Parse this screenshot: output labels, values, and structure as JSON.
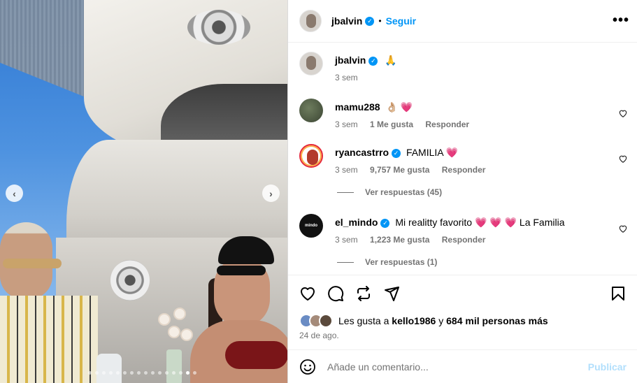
{
  "header": {
    "username": "jbalvin",
    "separator": "•",
    "follow_label": "Seguir",
    "more_label": "•••"
  },
  "caption": {
    "username": "jbalvin",
    "text": "🙏",
    "time": "3 sem"
  },
  "comments": [
    {
      "username": "mamu288",
      "text": "👌🏼 💗",
      "time": "3 sem",
      "likes": "1 Me gusta",
      "reply_label": "Responder",
      "verified": false
    },
    {
      "username": "ryancastrro",
      "text": "FAMILIA 💗",
      "time": "3 sem",
      "likes": "9,757 Me gusta",
      "reply_label": "Responder",
      "verified": true,
      "view_replies": "Ver respuestas (45)"
    },
    {
      "username": "el_mindo",
      "text": "Mi realitty favorito 💗 💗 💗  La Familia",
      "time": "3 sem",
      "likes": "1,223 Me gusta",
      "reply_label": "Responder",
      "verified": true,
      "view_replies": "Ver respuestas (1)",
      "avatar_text": "mindo"
    }
  ],
  "likes": {
    "prefix": "Les gusta a",
    "user": "kello1986",
    "connector": "y",
    "others": "684 mil personas más"
  },
  "date": "24 de ago.",
  "add_comment": {
    "placeholder": "Añade un comentario...",
    "publish_label": "Publicar"
  },
  "carousel": {
    "total_slides": 16,
    "active_slide": 15,
    "prev_label": "‹",
    "next_label": "›"
  },
  "colors": {
    "accent": "#0095f6",
    "verified": "#0095f6",
    "publish_disabled": "#b2dffc",
    "meta_text": "#737373"
  },
  "icons": [
    "heart-icon",
    "comment-icon",
    "repost-icon",
    "share-icon",
    "bookmark-icon",
    "emoji-icon",
    "verified-icon",
    "more-icon"
  ]
}
